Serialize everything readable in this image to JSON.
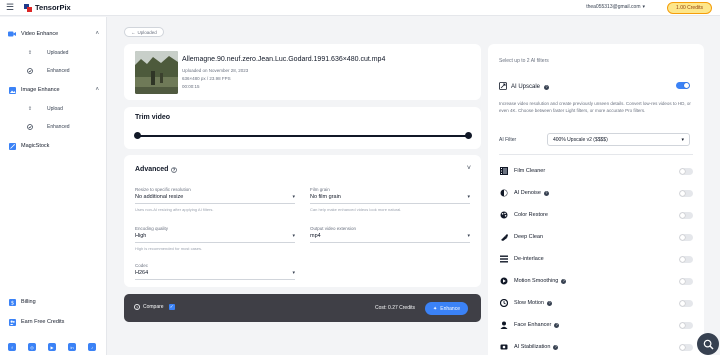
{
  "app": {
    "name": "TensorPix"
  },
  "header": {
    "user_email": "thea055313@gmail.com",
    "credits_label": "1.00 Credits"
  },
  "sidebar": {
    "groups": [
      {
        "label": "Video Enhance",
        "items": [
          {
            "label": "Uploaded"
          },
          {
            "label": "Enhanced"
          }
        ]
      },
      {
        "label": "Image Enhance",
        "items": [
          {
            "label": "Upload"
          },
          {
            "label": "Enhanced"
          }
        ]
      },
      {
        "label": "MagicStock"
      }
    ],
    "bottom": [
      {
        "label": "Billing"
      },
      {
        "label": "Earn Free Credits"
      }
    ],
    "social_icons": [
      "facebook-icon",
      "instagram-icon",
      "youtube-icon",
      "linkedin-icon",
      "tiktok-icon"
    ]
  },
  "main": {
    "back_label": "Uploaded",
    "file": {
      "name": "Allemagne.90.neuf.zero.Jean.Luc.Godard.1991.636×480.cut.mp4",
      "uploaded": "Uploaded on November 28, 2023",
      "resolution": "636×480 px / 23.98 FPS",
      "duration": "00:00:15"
    },
    "trim": {
      "title": "Trim video",
      "start_fraction": 0.0,
      "end_fraction": 1.0
    },
    "advanced": {
      "title": "Advanced",
      "fields": [
        {
          "label": "Resize to specific resolution",
          "value": "No additional resize",
          "help": "Uses non-AI resizing after applying AI filters."
        },
        {
          "label": "Film grain",
          "value": "No film grain",
          "help": "Can help make enhanced videos look more natural."
        },
        {
          "label": "Encoding quality",
          "value": "High",
          "help": "High is recommended for most cases."
        },
        {
          "label": "Output video extension",
          "value": "mp4",
          "help": ""
        },
        {
          "label": "Codec",
          "value": "H264",
          "help": ""
        }
      ]
    },
    "bottom_bar": {
      "compare_label": "Compare",
      "compare_checked": true,
      "cost_label": "Cost: 0.27 Credits",
      "enhance_label": "Enhance"
    }
  },
  "filters": {
    "title": "Select up to 2 AI filters",
    "main": {
      "name": "AI Upscale",
      "enabled": true,
      "description": "Increase video resolution and create previously unseen details. Convert low-res videos to HD, or even 4K. Choose between faster Light filters, or more accurate Pro filters.",
      "filter_label": "AI Filter",
      "selected_option": "400% Upscale v2 ($$$$)"
    },
    "items": [
      {
        "name": "Film Cleaner",
        "icon": "film-icon",
        "enabled": false,
        "has_help": false
      },
      {
        "name": "AI Denoise",
        "icon": "denoise-icon",
        "enabled": false,
        "has_help": true
      },
      {
        "name": "Color Restore",
        "icon": "palette-icon",
        "enabled": false,
        "has_help": false
      },
      {
        "name": "Deep Clean",
        "icon": "deep-clean-icon",
        "enabled": false,
        "has_help": false
      },
      {
        "name": "De-interlace",
        "icon": "deinterlace-icon",
        "enabled": false,
        "has_help": false
      },
      {
        "name": "Motion Smoothing",
        "icon": "motion-icon",
        "enabled": false,
        "has_help": true
      },
      {
        "name": "Slow Motion",
        "icon": "slow-motion-icon",
        "enabled": false,
        "has_help": true
      },
      {
        "name": "Face Enhancer",
        "icon": "face-icon",
        "enabled": false,
        "has_help": true
      },
      {
        "name": "AI Stabilization",
        "icon": "stabilization-icon",
        "enabled": false,
        "has_help": true
      }
    ]
  },
  "colors": {
    "accent": "#3b82f6",
    "credits_bg": "#fde68a",
    "bottom_bar": "#3f3f46"
  }
}
